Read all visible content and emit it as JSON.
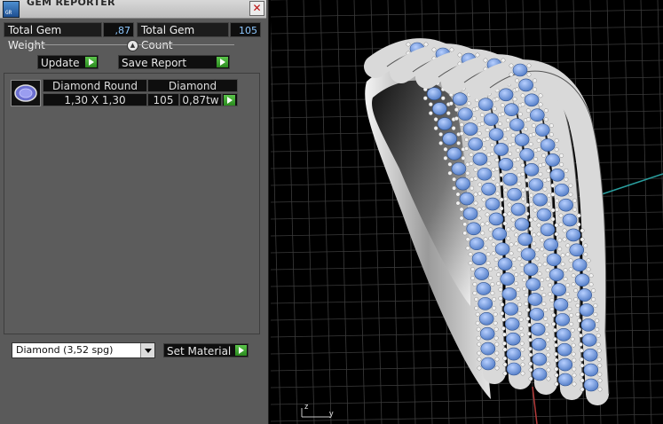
{
  "panel": {
    "title": "GEM REPORTER",
    "icon_name": "gem-reporter-icon",
    "close_glyph": "✕",
    "stats": {
      "total_weight_label": "Total Gem Weight",
      "total_weight_value": ",87",
      "total_count_label": "Total Gem Count",
      "total_count_value": "105"
    },
    "collapse_glyph": "▲",
    "buttons": {
      "update": "Update",
      "save_report": "Save Report",
      "set_material": "Set Material"
    },
    "gem_table": {
      "rows": [
        {
          "icon_name": "gem-oval-icon",
          "shape": "Diamond Round",
          "material": "Diamond",
          "size": "1,30 X 1,30",
          "count": "105",
          "weight": "0,87tw"
        }
      ]
    },
    "material_select": {
      "value": "Diamond     (3,52 spg)"
    }
  },
  "viewport": {
    "background": "#000000",
    "grid_color": "#3b3b3b",
    "axis_x_color": "#b33a3a",
    "axis_y_color": "#2aa0a0",
    "axis_labels": {
      "z": "z",
      "y": "y"
    },
    "model_colors": {
      "metal": "#d9d9d9",
      "gem": "#6f9be0"
    }
  }
}
